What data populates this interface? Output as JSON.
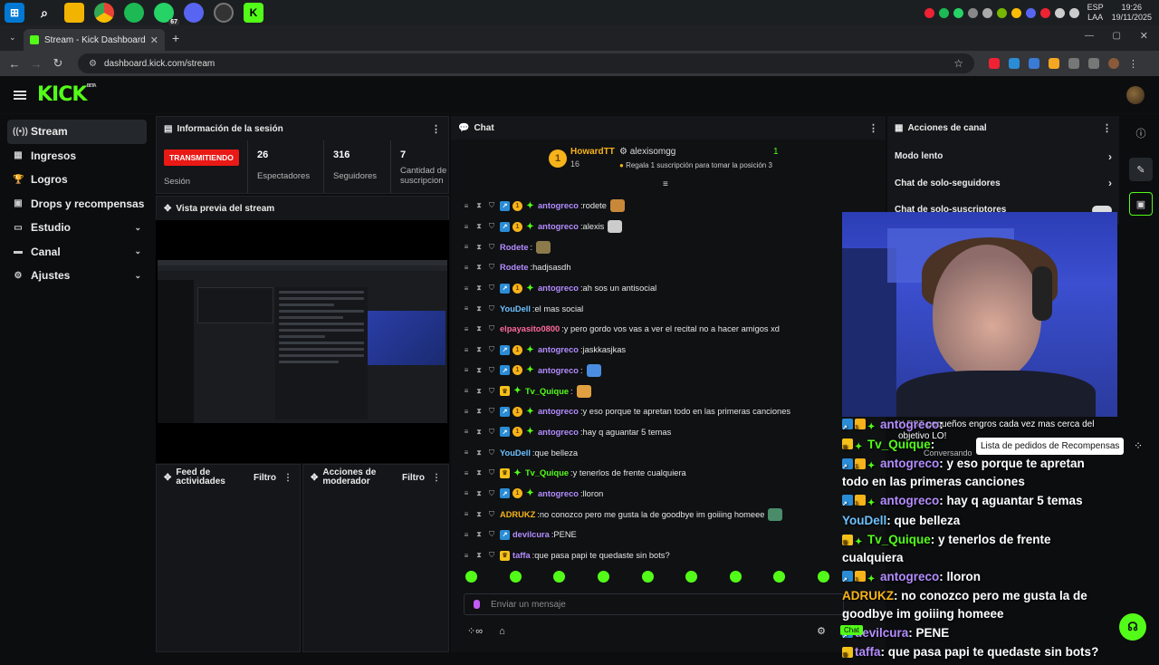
{
  "taskbar": {
    "lang": "ESP",
    "lang2": "LAA",
    "time": "19:26",
    "date": "19/11/2025",
    "whatsapp_badge": "67"
  },
  "browser": {
    "tab_title": "Stream - Kick Dashboard",
    "url": "dashboard.kick.com/stream"
  },
  "brand": {
    "logo": "KICK",
    "beta": "BETA",
    "accent": "#53fc18"
  },
  "sidebar": {
    "items": [
      {
        "label": "Stream",
        "icon": "stream-icon",
        "glyph": "((•))"
      },
      {
        "label": "Ingresos",
        "icon": "money-icon",
        "glyph": "▦"
      },
      {
        "label": "Logros",
        "icon": "trophy-icon",
        "glyph": "🏆"
      },
      {
        "label": "Drops y recompensas",
        "icon": "gift-icon",
        "glyph": "▣"
      },
      {
        "label": "Estudio",
        "icon": "studio-icon",
        "glyph": "▭"
      },
      {
        "label": "Canal",
        "icon": "channel-icon",
        "glyph": "▬"
      },
      {
        "label": "Ajustes",
        "icon": "settings-icon",
        "glyph": "⚙"
      }
    ]
  },
  "session": {
    "title": "Información de la sesión",
    "live_badge": "TRANSMITIENDO",
    "session_label": "Sesión",
    "viewers_value": "26",
    "viewers_label": "Espectadores",
    "followers_value": "316",
    "followers_label": "Seguidores",
    "subs_value": "7",
    "subs_label_1": "Cantidad de",
    "subs_label_2": "suscripcion"
  },
  "preview": {
    "title": "Vista previa del stream"
  },
  "activity": {
    "title_1": "Feed de",
    "title_2": "actividades",
    "filter": "Filtro"
  },
  "modactions": {
    "title_1": "Acciones de",
    "title_2": "moderador",
    "filter": "Filtro"
  },
  "chat": {
    "title": "Chat",
    "pinned_user": "HowardTT",
    "pinned_count": "16",
    "pinned_target": "alexisomgg",
    "pinned_num": "1",
    "pinned_text": "Regala 1 suscripción para tomar la posición 3",
    "input_placeholder": "Enviar un mensaje",
    "footer_chat": "Chat",
    "messages": [
      {
        "user": "antogreco",
        "color": "#b48cff",
        "text": "rodete",
        "badges": "sub-coin-star",
        "emote": "#c8883a"
      },
      {
        "user": "antogreco",
        "color": "#b48cff",
        "text": "alexis",
        "badges": "sub-coin-star",
        "emote": "#cccccc"
      },
      {
        "user": "Rodete",
        "color": "#b48cff",
        "text": "",
        "badges": "",
        "emote": "#8c7a4a"
      },
      {
        "user": "Rodete",
        "color": "#b48cff",
        "text": "hadjsasdh",
        "badges": "",
        "emote": ""
      },
      {
        "user": "antogreco",
        "color": "#b48cff",
        "text": "ah sos un antisocial",
        "badges": "sub-coin-star",
        "emote": ""
      },
      {
        "user": "YouDell",
        "color": "#6ec1ff",
        "text": "el mas social",
        "badges": "",
        "emote": ""
      },
      {
        "user": "elpayasito0800",
        "color": "#ff6a9a",
        "text": "y pero gordo vos vas a ver el recital no a hacer amigos xd",
        "badges": "",
        "emote": ""
      },
      {
        "user": "antogreco",
        "color": "#b48cff",
        "text": "jaskkasjkas",
        "badges": "sub-coin-star",
        "emote": ""
      },
      {
        "user": "antogreco",
        "color": "#b48cff",
        "text": "",
        "badges": "sub-coin-star",
        "emote": "#4a8de0"
      },
      {
        "user": "Tv_Quique",
        "color": "#53fc18",
        "text": "",
        "badges": "crown-star",
        "emote": "#e0a040"
      },
      {
        "user": "antogreco",
        "color": "#b48cff",
        "text": "y eso porque te apretan todo en las primeras canciones",
        "badges": "sub-coin-star",
        "emote": ""
      },
      {
        "user": "antogreco",
        "color": "#b48cff",
        "text": "hay q aguantar 5 temas",
        "badges": "sub-coin-star",
        "emote": ""
      },
      {
        "user": "YouDell",
        "color": "#6ec1ff",
        "text": "que belleza",
        "badges": "",
        "emote": ""
      },
      {
        "user": "Tv_Quique",
        "color": "#53fc18",
        "text": "y tenerlos de frente cualquiera",
        "badges": "crown-star",
        "emote": ""
      },
      {
        "user": "antogreco",
        "color": "#b48cff",
        "text": "lloron",
        "badges": "sub-coin-star",
        "emote": ""
      },
      {
        "user": "ADRUKZ",
        "color": "#f7b31a",
        "text": "no conozco pero me gusta la de goodbye im goiiing homeee",
        "badges": "",
        "emote": "#4a8c6a"
      },
      {
        "user": "devilcura",
        "color": "#b48cff",
        "text": "PENE",
        "badges": "sub",
        "emote": ""
      },
      {
        "user": "taffa",
        "color": "#b48cff",
        "text": "que pasa papi te quedaste sin bots?",
        "badges": "crown",
        "emote": ""
      }
    ]
  },
  "channel_actions": {
    "title": "Acciones de canal",
    "slow_mode": "Modo lento",
    "followers_only": "Chat de solo-seguidores",
    "subs_only": "Chat de solo-suscriptores"
  },
  "overlay": {
    "fragment_1": "Y EST",
    "fragment_2": "pequeños engros cada vez mas cerca del objetivo LO!",
    "fragment_3": "Conversando",
    "tooltip": "Lista de pedidos de Recompensas",
    "lines": [
      {
        "user": "antogreco",
        "color": "#b48cff",
        "text": "",
        "badges": "sub-coin-star"
      },
      {
        "user": "Tv_Quique",
        "color": "#53fc18",
        "text": "",
        "badges": "crown-star"
      },
      {
        "user": "antogreco",
        "color": "#b48cff",
        "text": "y eso porque te apretan todo en las primeras canciones",
        "badges": "sub-coin-star"
      },
      {
        "user": "antogreco",
        "color": "#b48cff",
        "text": "hay q aguantar 5 temas",
        "badges": "sub-coin-star"
      },
      {
        "user": "YouDell",
        "color": "#6ec1ff",
        "text": "que belleza",
        "badges": ""
      },
      {
        "user": "Tv_Quique",
        "color": "#53fc18",
        "text": "y tenerlos de frente cualquiera",
        "badges": "crown-star"
      },
      {
        "user": "antogreco",
        "color": "#b48cff",
        "text": "lloron",
        "badges": "sub-coin-star"
      },
      {
        "user": "ADRUKZ",
        "color": "#f7b31a",
        "text": "no conozco pero me gusta la de goodbye im goiiing homeee",
        "badges": ""
      },
      {
        "user": "devilcura",
        "color": "#b48cff",
        "text": "PENE",
        "badges": "sub"
      },
      {
        "user": "taffa",
        "color": "#b48cff",
        "text": "que pasa papi te quedaste sin bots?",
        "badges": "crown"
      }
    ]
  }
}
